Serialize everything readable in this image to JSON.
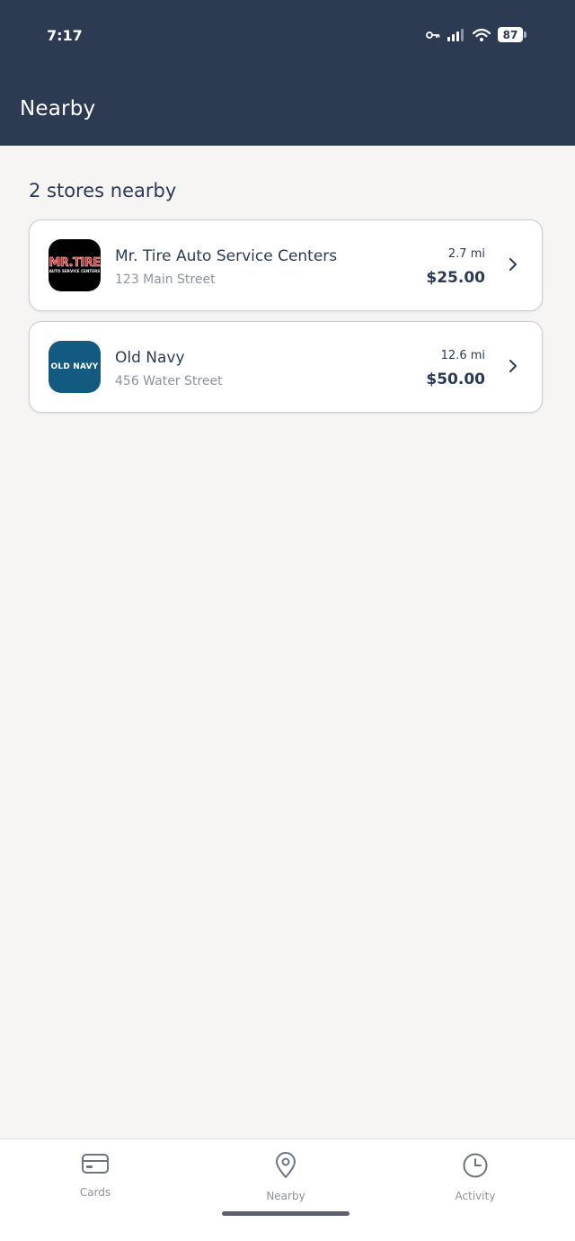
{
  "status_bar": {
    "time": "7:17",
    "battery": "87"
  },
  "header": {
    "title": "Nearby"
  },
  "main": {
    "section_title": "2 stores nearby",
    "stores": [
      {
        "name": "Mr. Tire Auto Service Centers",
        "address": "123 Main Street",
        "distance": "2.7 mi",
        "price": "$25.00",
        "logo_text": "MR.TIRE",
        "logo_subtext": "AUTO SERVICE CENTERS"
      },
      {
        "name": "Old Navy",
        "address": "456 Water Street",
        "distance": "12.6 mi",
        "price": "$50.00",
        "logo_text": "OLD NAVY"
      }
    ]
  },
  "bottom_nav": {
    "items": [
      {
        "label": "Cards",
        "icon": "card-icon"
      },
      {
        "label": "Nearby",
        "icon": "location-pin-icon"
      },
      {
        "label": "Activity",
        "icon": "clock-icon"
      }
    ]
  },
  "colors": {
    "header_bg": "#2c3a52",
    "page_bg": "#f6f5f3",
    "text_primary": "#2b3a55",
    "text_secondary": "#8c929e",
    "old_navy_logo": "#135a80",
    "mr_tire_red": "#e02626"
  }
}
